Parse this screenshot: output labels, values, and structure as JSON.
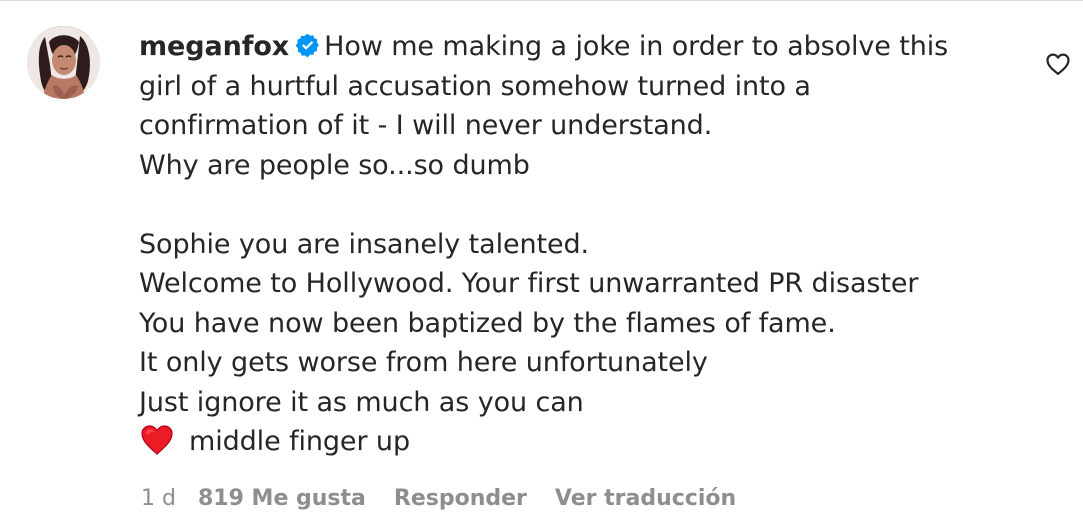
{
  "comment": {
    "username": "meganfox",
    "verified_icon": "verified-badge",
    "lines": [
      "How me making a joke in order to absolve this",
      "girl of a hurtful accusation somehow turned into a",
      "confirmation of it - I will never understand.",
      "Why are people so...so dumb",
      "",
      "Sophie you are insanely talented.",
      "Welcome to Hollywood. Your first unwarranted PR disaster",
      "You have now been baptized by the flames of fame.",
      "It only gets worse from here unfortunately",
      "Just ignore it as much as you can",
      "middle finger up"
    ],
    "emoji": "red-heart"
  },
  "meta": {
    "time": "1 d",
    "likes": "819 Me gusta",
    "reply": "Responder",
    "translate": "Ver traducción"
  },
  "icons": {
    "like": "heart-outline-icon"
  },
  "colors": {
    "text": "#262626",
    "secondary": "#8e8e8e",
    "verified": "#0095f6",
    "heart": "#ed1c24"
  }
}
